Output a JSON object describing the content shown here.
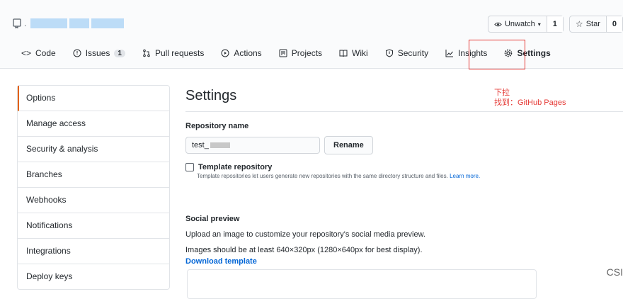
{
  "repo": {
    "title_mark": "."
  },
  "actions": {
    "watch_label": "Unwatch",
    "watch_count": "1",
    "star_label": "Star",
    "star_count": "0"
  },
  "tabs": [
    {
      "label": "Code",
      "icon": "code-icon"
    },
    {
      "label": "Issues",
      "icon": "issue-icon",
      "badge": "1"
    },
    {
      "label": "Pull requests",
      "icon": "pull-request-icon"
    },
    {
      "label": "Actions",
      "icon": "play-icon"
    },
    {
      "label": "Projects",
      "icon": "project-icon"
    },
    {
      "label": "Wiki",
      "icon": "book-icon"
    },
    {
      "label": "Security",
      "icon": "shield-icon"
    },
    {
      "label": "Insights",
      "icon": "graph-icon"
    },
    {
      "label": "Settings",
      "icon": "gear-icon"
    }
  ],
  "sidebar": {
    "items": [
      "Options",
      "Manage access",
      "Security & analysis",
      "Branches",
      "Webhooks",
      "Notifications",
      "Integrations",
      "Deploy keys"
    ]
  },
  "main": {
    "title": "Settings",
    "repo_name_label": "Repository name",
    "repo_name_value": "test_",
    "rename_label": "Rename",
    "template_label": "Template repository",
    "template_desc": "Template repositories let users generate new repositories with the same directory structure and files.",
    "learn_more": "Learn more.",
    "social_label": "Social preview",
    "social_text": "Upload an image to customize your repository's social media preview.",
    "social_size": "Images should be at least 640×320px (1280×640px for best display).",
    "download_template": "Download template"
  },
  "annotation": {
    "line1": "下拉",
    "line2": "找到：GitHub Pages"
  },
  "watermark": "CSI",
  "colors": {
    "annotation": "#e53935",
    "link": "#0366d6",
    "active_tab_border": "#e36209"
  }
}
